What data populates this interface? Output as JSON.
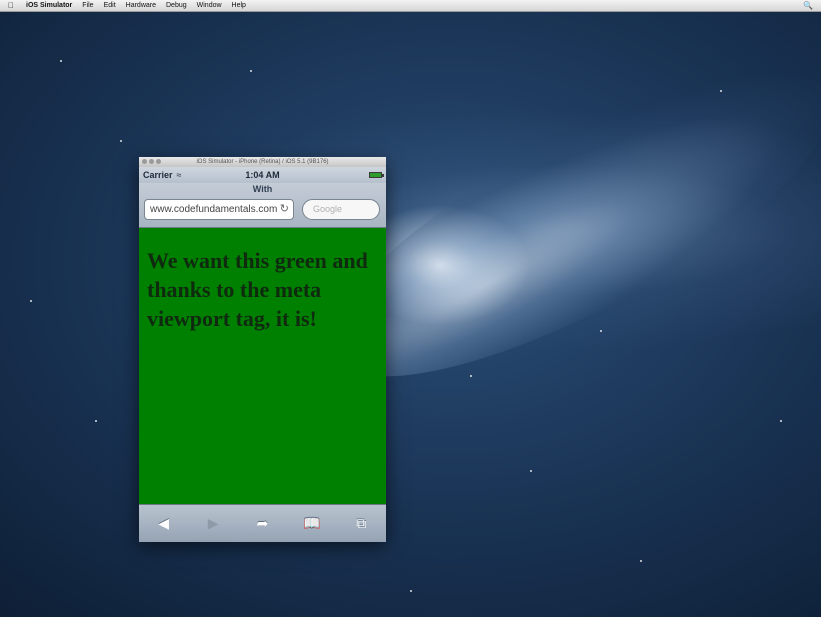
{
  "menubar": {
    "app_name": "iOS Simulator",
    "items": [
      "File",
      "Edit",
      "Hardware",
      "Debug",
      "Window",
      "Help"
    ],
    "apple_icon": "apple-logo-icon",
    "spotlight_icon": "spotlight-search-icon"
  },
  "simulator": {
    "window_title": "iOS Simulator - iPhone (Retina) / iOS 5.1 (9B176)",
    "status_bar": {
      "carrier": "Carrier",
      "time": "1:04 AM",
      "wifi_icon": "wifi-icon",
      "battery_icon": "battery-icon"
    },
    "safari": {
      "page_title": "With",
      "url": "www.codefundamentals.com",
      "search_placeholder": "Google"
    },
    "page": {
      "heading": "We want this green and thanks to the meta viewport tag, it is!",
      "background_color": "#008000"
    },
    "toolbar": {
      "icons": [
        "back-icon",
        "forward-icon",
        "share-icon",
        "bookmarks-icon",
        "tabs-icon"
      ]
    }
  }
}
